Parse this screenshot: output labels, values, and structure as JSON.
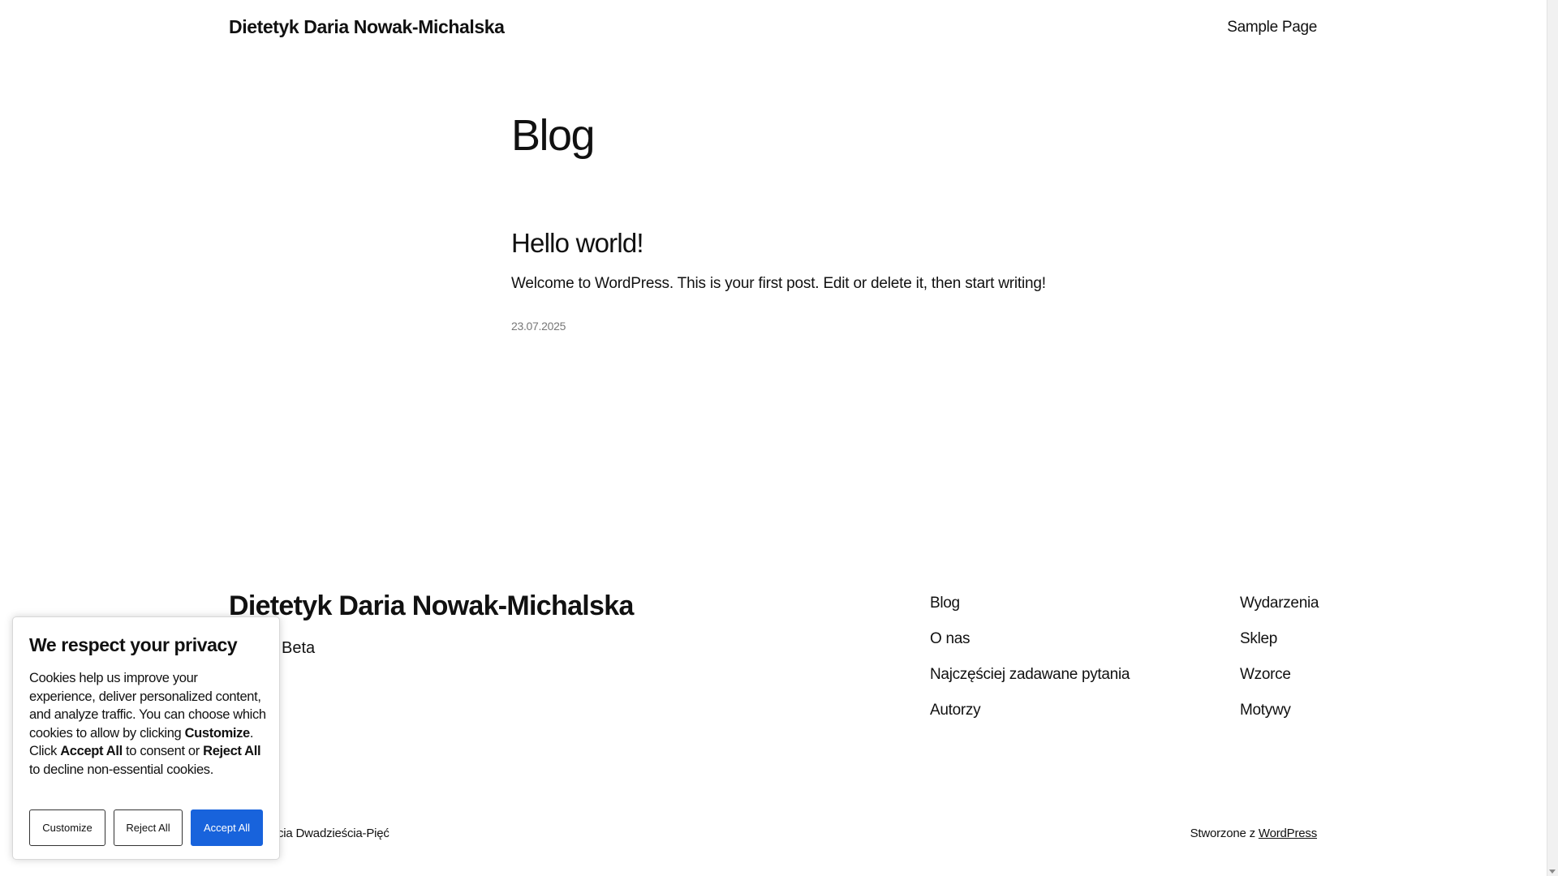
{
  "header": {
    "site_title": "Dietetyk Daria Nowak-Michalska",
    "nav_link": "Sample Page"
  },
  "main": {
    "heading": "Blog",
    "posts": [
      {
        "title": "Hello world!",
        "excerpt": "Welcome to WordPress. This is your first post. Edit or delete it, then start writing!",
        "date": "23.07.2025"
      }
    ]
  },
  "footer": {
    "site_title": "Dietetyk Daria Nowak-Michalska",
    "tagline": "Beta",
    "nav_col1": [
      "Blog",
      "O nas",
      "Najczęściej zadawane pytania",
      "Autorzy"
    ],
    "nav_col2": [
      "Wydarzenia",
      "Sklep",
      "Wzorce",
      "Motywy"
    ],
    "bottom_left": "cia Dwadzieścia-Pięć",
    "bottom_right_prefix": "Stworzone z ",
    "bottom_right_link": "WordPress"
  },
  "cookie_banner": {
    "title": "We respect your privacy",
    "text_1": "Cookies help us improve your experience, deliver personalized content, and analyze traffic. You can choose which cookies to allow by clicking ",
    "bold_customize": "Customize",
    "text_2": ". Click ",
    "bold_accept": "Accept All",
    "text_3": " to consent or ",
    "bold_reject": "Reject All",
    "text_4": " to decline non-essential cookies.",
    "buttons": {
      "customize": "Customize",
      "reject": "Reject All",
      "accept": "Accept All"
    },
    "accent_color": "#1863dc"
  }
}
